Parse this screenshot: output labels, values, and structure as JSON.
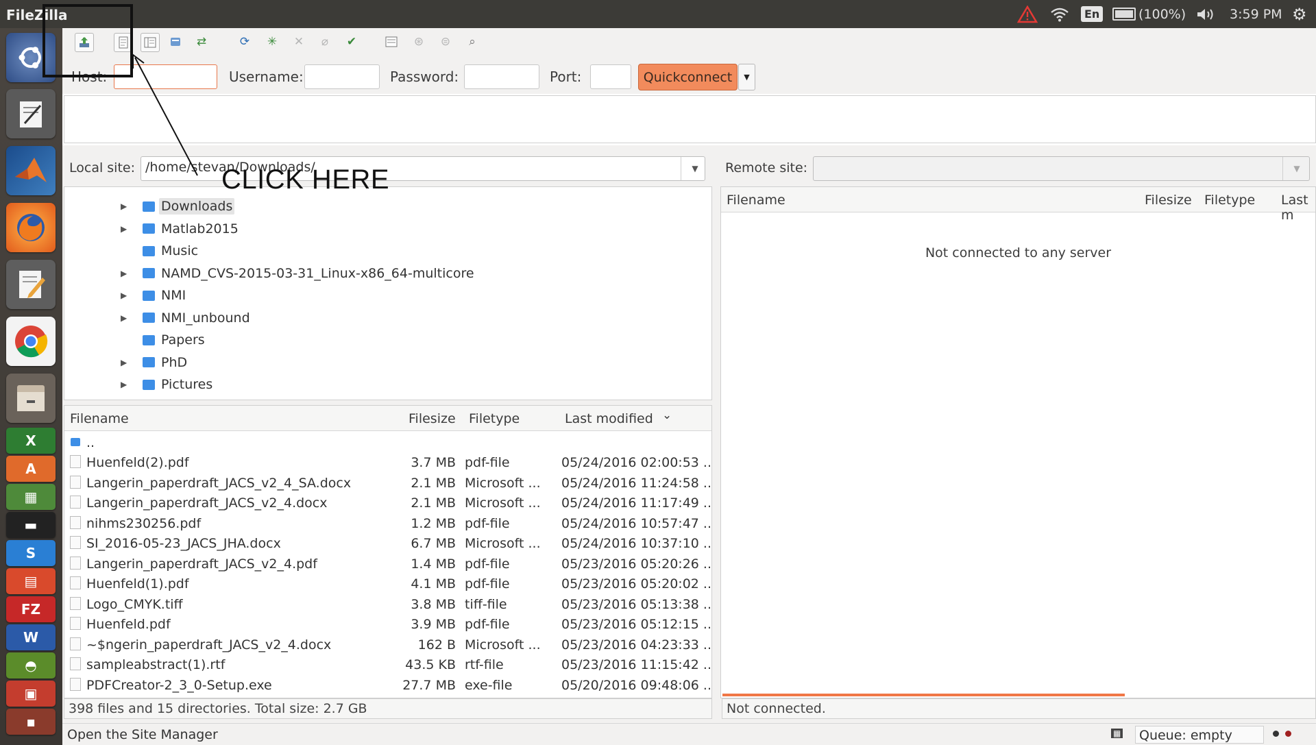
{
  "window": {
    "title": "FileZilla"
  },
  "tray": {
    "language": "En",
    "battery": "(100%)",
    "time": "3:59 PM"
  },
  "launcher": {
    "items": [
      "ubuntu-icon",
      "text-editor-icon",
      "matlab-icon",
      "firefox-icon",
      "gedit-icon",
      "chrome-icon",
      "files-icon",
      "excel-icon",
      "software-center-icon",
      "monitor-icon",
      "terminal-icon",
      "skype-icon",
      "scanner-icon",
      "filezilla-icon",
      "word-icon",
      "geogebra-icon",
      "impress-icon"
    ]
  },
  "quickconnect": {
    "host_label": "Host:",
    "username_label": "Username:",
    "password_label": "Password:",
    "port_label": "Port:",
    "button_label": "Quickconnect",
    "host_value": "",
    "username_value": "",
    "password_value": "",
    "port_value": ""
  },
  "local": {
    "site_label": "Local site:",
    "path": "/home/stevan/Downloads/",
    "tree": [
      {
        "name": "Downloads",
        "expander": true,
        "selected": true
      },
      {
        "name": "Matlab2015",
        "expander": true
      },
      {
        "name": "Music",
        "expander": false
      },
      {
        "name": "NAMD_CVS-2015-03-31_Linux-x86_64-multicore",
        "expander": true
      },
      {
        "name": "NMI",
        "expander": true
      },
      {
        "name": "NMI_unbound",
        "expander": true
      },
      {
        "name": "Papers",
        "expander": false
      },
      {
        "name": "PhD",
        "expander": true
      },
      {
        "name": "Pictures",
        "expander": true
      }
    ],
    "columns": {
      "filename": "Filename",
      "filesize": "Filesize",
      "filetype": "Filetype",
      "modified": "Last modified"
    },
    "parent_dir": "..",
    "files": [
      {
        "name": "Huenfeld(2).pdf",
        "size": "3.7 MB",
        "type": "pdf-file",
        "modified": "05/24/2016 02:00:53 ..."
      },
      {
        "name": "Langerin_paperdraft_JACS_v2_4_SA.docx",
        "size": "2.1 MB",
        "type": "Microsoft ...",
        "modified": "05/24/2016 11:24:58 ..."
      },
      {
        "name": "Langerin_paperdraft_JACS_v2_4.docx",
        "size": "2.1 MB",
        "type": "Microsoft ...",
        "modified": "05/24/2016 11:17:49 ..."
      },
      {
        "name": "nihms230256.pdf",
        "size": "1.2 MB",
        "type": "pdf-file",
        "modified": "05/24/2016 10:57:47 ..."
      },
      {
        "name": "SI_2016-05-23_JACS_JHA.docx",
        "size": "6.7 MB",
        "type": "Microsoft ...",
        "modified": "05/24/2016 10:37:10 ..."
      },
      {
        "name": "Langerin_paperdraft_JACS_v2_4.pdf",
        "size": "1.4 MB",
        "type": "pdf-file",
        "modified": "05/23/2016 05:20:26 ..."
      },
      {
        "name": "Huenfeld(1).pdf",
        "size": "4.1 MB",
        "type": "pdf-file",
        "modified": "05/23/2016 05:20:02 ..."
      },
      {
        "name": "Logo_CMYK.tiff",
        "size": "3.8 MB",
        "type": "tiff-file",
        "modified": "05/23/2016 05:13:38 ..."
      },
      {
        "name": "Huenfeld.pdf",
        "size": "3.9 MB",
        "type": "pdf-file",
        "modified": "05/23/2016 05:12:15 ..."
      },
      {
        "name": "~$ngerin_paperdraft_JACS_v2_4.docx",
        "size": "162 B",
        "type": "Microsoft ...",
        "modified": "05/23/2016 04:23:33 ..."
      },
      {
        "name": "sampleabstract(1).rtf",
        "size": "43.5 KB",
        "type": "rtf-file",
        "modified": "05/23/2016 11:15:42 ..."
      },
      {
        "name": "PDFCreator-2_3_0-Setup.exe",
        "size": "27.7 MB",
        "type": "exe-file",
        "modified": "05/20/2016 09:48:06 ..."
      }
    ],
    "status": "398 files and 15 directories. Total size: 2.7 GB"
  },
  "remote": {
    "site_label": "Remote site:",
    "path": "",
    "columns": {
      "filename": "Filename",
      "filesize": "Filesize",
      "filetype": "Filetype",
      "modified": "Last m"
    },
    "empty_message": "Not connected to any server",
    "status": "Not connected."
  },
  "statusbar": {
    "hint": "Open the Site Manager",
    "queue": "Queue: empty"
  },
  "annotation": {
    "text": "CLICK HERE"
  },
  "colors": {
    "accent": "#f28b5c",
    "folder": "#3d8ee6",
    "progress": "#f07746"
  }
}
